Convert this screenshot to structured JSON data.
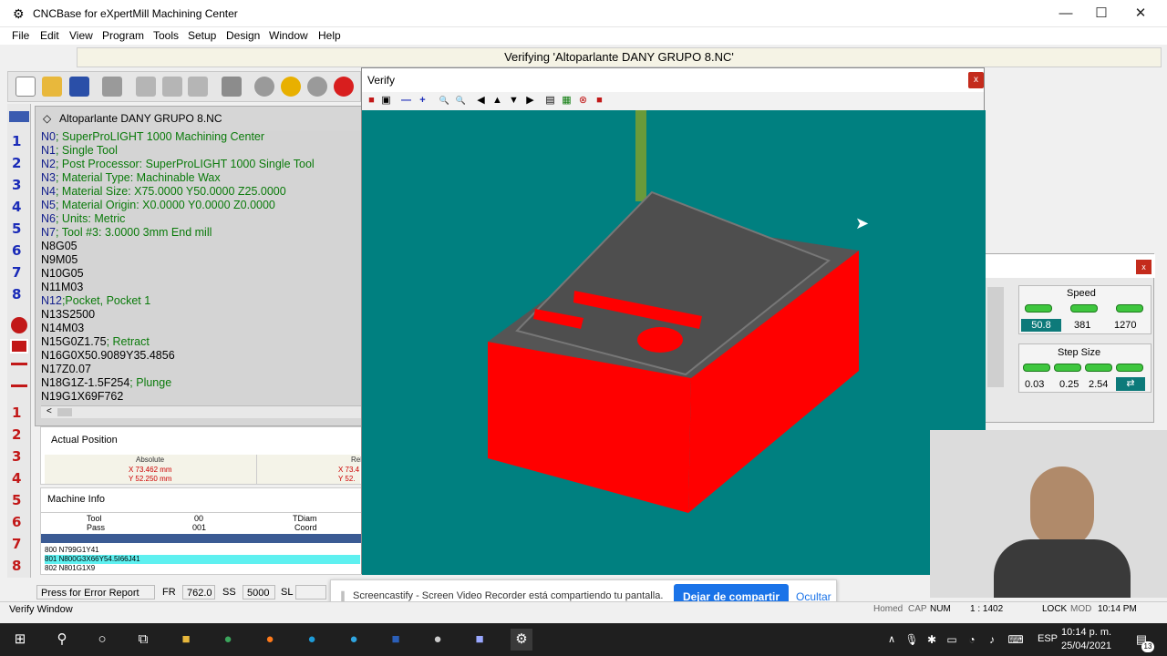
{
  "window": {
    "title": "CNCBase for eXpertMill Machining Center",
    "minimize": "—",
    "maximize": "☐",
    "close": "✕"
  },
  "menu": [
    "File",
    "Edit",
    "View",
    "Program",
    "Tools",
    "Setup",
    "Design",
    "Window",
    "Help"
  ],
  "status_line": "Verifying 'Altoparlante DANY  GRUPO 8.NC'",
  "left_numbers": [
    "1",
    "2",
    "3",
    "4",
    "5",
    "6",
    "7",
    "8",
    "1",
    "2",
    "3",
    "4",
    "5",
    "6",
    "7",
    "8"
  ],
  "editor": {
    "title": "Altoparlante DANY  GRUPO 8.NC",
    "lines": [
      {
        "a": "N0",
        "b": "; SuperProLIGHT 1000 Machining Center"
      },
      {
        "a": "N1",
        "b": "; Single Tool"
      },
      {
        "a": "N2",
        "b": "; Post Processor: SuperProLIGHT 1000 Single Tool"
      },
      {
        "a": "N3",
        "b": "; Material Type: Machinable Wax"
      },
      {
        "a": "N4",
        "b": "; Material Size: X75.0000 Y50.0000 Z25.0000"
      },
      {
        "a": "N5",
        "b": "; Material Origin: X0.0000 Y0.0000 Z0.0000"
      },
      {
        "a": "N6",
        "b": "; Units: Metric"
      },
      {
        "a": "N7",
        "b": "; Tool #3: 3.0000  3mm End mill"
      },
      {
        "a": "N8G05",
        "b": ""
      },
      {
        "a": "N9M05",
        "b": ""
      },
      {
        "a": "N10G05",
        "b": ""
      },
      {
        "a": "N11M03",
        "b": ""
      },
      {
        "a": "N12",
        "b": ";Pocket, Pocket 1"
      },
      {
        "a": "N13S2500",
        "b": ""
      },
      {
        "a": "N14M03",
        "b": ""
      },
      {
        "a": "N15G0Z1.75",
        "b": "; Retract"
      },
      {
        "a": "N16G0X50.9089Y35.4856",
        "b": ""
      },
      {
        "a": "N17Z0.07",
        "b": ""
      },
      {
        "a": "N18G1Z-1.5F254",
        "b": "; Plunge"
      },
      {
        "a": "N19G1X69F762",
        "b": ""
      }
    ],
    "scroll_left": "<"
  },
  "actual_position": {
    "title": "Actual Position",
    "col_absolute": "Absolute",
    "col_relative": "Rel",
    "rows": [
      {
        "abs": "X  73.462 mm",
        "rel": "X  73.4"
      },
      {
        "abs": "Y  52.250 mm",
        "rel": "Y  52."
      }
    ]
  },
  "machine_info": {
    "title": "Machine Info",
    "row1": [
      "Tool",
      "00",
      "TDiam"
    ],
    "row2": [
      "Pass",
      "001",
      "Coord"
    ],
    "list": [
      "800 N799G1Y41",
      "801 N800G3X66Y54.5I66J41",
      "802 N801G1X9"
    ]
  },
  "status_fields": [
    "Press for Error Report",
    "FR",
    "762.0",
    "SS",
    "5000",
    "SL"
  ],
  "verify": {
    "title": "Verify",
    "close": "x",
    "tool_icons": [
      "■",
      "▣",
      "—",
      "+",
      "🔍",
      "🔍",
      "◀",
      "▲",
      "▼",
      "▶",
      "▤",
      "▦",
      "⊗",
      "■"
    ]
  },
  "speed": {
    "label": "Speed",
    "values": [
      "50.8",
      "381",
      "1270"
    ]
  },
  "step_size": {
    "label": "Step Size",
    "values": [
      "0.03",
      "0.25",
      "2.54"
    ]
  },
  "panel_close": "x",
  "notification": {
    "text": "Screencastify - Screen Video Recorder está compartiendo tu pantalla.",
    "share": "Dejar de compartir",
    "hide": "Ocultar"
  },
  "bottom": {
    "left": "Verify Window",
    "homed": "Homed",
    "cap": "CAP",
    "num": "NUM",
    "pos": "1 : 1402",
    "lock": "LOCK",
    "mod": "MOD",
    "clock": "10:14 PM"
  },
  "taskbar": {
    "lang": "ESP",
    "time": "10:14 p. m.",
    "date": "25/04/2021",
    "badge": "13"
  },
  "colors": {
    "viewport": "#008080",
    "stock": "#ff0000",
    "accent": "#1a73e8"
  }
}
